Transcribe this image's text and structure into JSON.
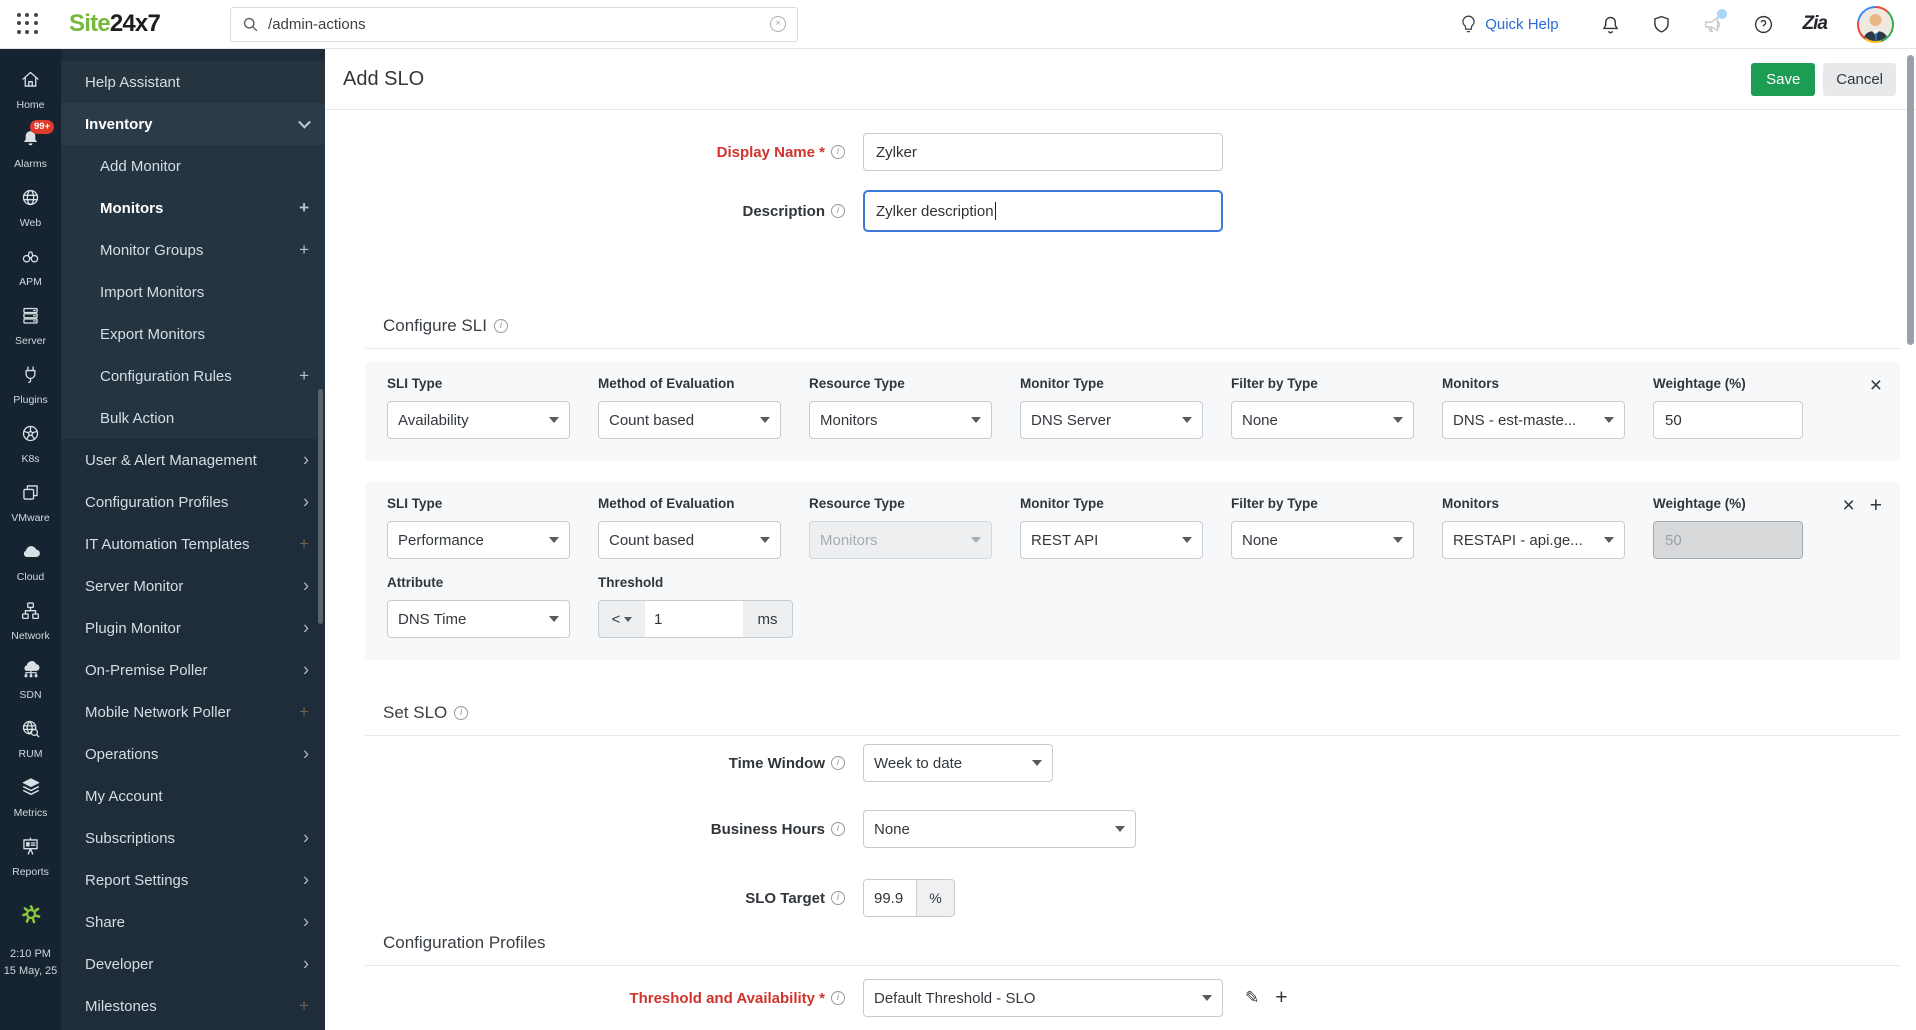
{
  "topbar": {
    "logo_primary": "Site",
    "logo_secondary": "24x7",
    "search_value": "/admin-actions",
    "quick_help": "Quick Help",
    "zia": "Zia"
  },
  "rail": {
    "items": [
      {
        "id": "home",
        "label": "Home",
        "icon": "home-icon"
      },
      {
        "id": "alarms",
        "label": "Alarms",
        "icon": "bell-icon",
        "badge": "99+"
      },
      {
        "id": "web",
        "label": "Web",
        "icon": "globe-icon"
      },
      {
        "id": "apm",
        "label": "APM",
        "icon": "binoculars-icon"
      },
      {
        "id": "server",
        "label": "Server",
        "icon": "server-icon"
      },
      {
        "id": "plugins",
        "label": "Plugins",
        "icon": "plug-icon"
      },
      {
        "id": "k8s",
        "label": "K8s",
        "icon": "kubernetes-icon"
      },
      {
        "id": "vmware",
        "label": "VMware",
        "icon": "vmware-icon"
      },
      {
        "id": "cloud",
        "label": "Cloud",
        "icon": "cloud-icon"
      },
      {
        "id": "network",
        "label": "Network",
        "icon": "network-icon"
      },
      {
        "id": "sdn",
        "label": "SDN",
        "icon": "sdn-icon"
      },
      {
        "id": "rum",
        "label": "RUM",
        "icon": "rum-icon"
      },
      {
        "id": "metrics",
        "label": "Metrics",
        "icon": "layers-icon"
      },
      {
        "id": "reports",
        "label": "Reports",
        "icon": "presentation-icon"
      }
    ],
    "clock_time": "2:10 PM",
    "clock_date": "15 May, 25"
  },
  "sidebar": {
    "items": [
      {
        "id": "help-assistant",
        "label": "Help Assistant",
        "style": "top-row"
      },
      {
        "id": "inventory",
        "label": "Inventory",
        "style": "section-open",
        "affordance": "chevron-down"
      },
      {
        "id": "add-monitor",
        "label": "Add Monitor",
        "style": "sub"
      },
      {
        "id": "monitors",
        "label": "Monitors",
        "style": "sub bold",
        "affordance": "plus"
      },
      {
        "id": "monitor-groups",
        "label": "Monitor Groups",
        "style": "sub",
        "affordance": "plus"
      },
      {
        "id": "import-monitors",
        "label": "Import Monitors",
        "style": "sub"
      },
      {
        "id": "export-monitors",
        "label": "Export Monitors",
        "style": "sub"
      },
      {
        "id": "configuration-rules",
        "label": "Configuration Rules",
        "style": "sub",
        "affordance": "plus"
      },
      {
        "id": "bulk-action",
        "label": "Bulk Action",
        "style": "sub"
      },
      {
        "id": "user-alert-management",
        "label": "User & Alert Management",
        "affordance": "chevron-right"
      },
      {
        "id": "configuration-profiles",
        "label": "Configuration Profiles",
        "affordance": "chevron-right"
      },
      {
        "id": "it-automation-templates",
        "label": "IT Automation Templates",
        "affordance": "plus-dim"
      },
      {
        "id": "server-monitor",
        "label": "Server Monitor",
        "affordance": "chevron-right"
      },
      {
        "id": "plugin-monitor",
        "label": "Plugin Monitor",
        "affordance": "chevron-right"
      },
      {
        "id": "on-premise-poller",
        "label": "On-Premise Poller",
        "affordance": "chevron-right"
      },
      {
        "id": "mobile-network-poller",
        "label": "Mobile Network Poller",
        "affordance": "plus-dim"
      },
      {
        "id": "operations",
        "label": "Operations",
        "affordance": "chevron-right"
      },
      {
        "id": "my-account",
        "label": "My Account"
      },
      {
        "id": "subscriptions",
        "label": "Subscriptions",
        "affordance": "chevron-right"
      },
      {
        "id": "report-settings",
        "label": "Report Settings",
        "affordance": "chevron-right"
      },
      {
        "id": "share",
        "label": "Share",
        "affordance": "chevron-right"
      },
      {
        "id": "developer",
        "label": "Developer",
        "affordance": "chevron-right"
      },
      {
        "id": "milestones",
        "label": "Milestones",
        "affordance": "plus-dim"
      }
    ]
  },
  "page": {
    "title": "Add SLO",
    "save": "Save",
    "cancel": "Cancel",
    "fields": {
      "display_name_label": "Display Name *",
      "display_name": "Zylker",
      "description_label": "Description",
      "description": "Zylker description"
    },
    "sli": {
      "heading": "Configure SLI",
      "columns": [
        "SLI Type",
        "Method of Evaluation",
        "Resource Type",
        "Monitor Type",
        "Filter by Type",
        "Monitors",
        "Weightage (%)"
      ],
      "rows": [
        {
          "sli_type": "Availability",
          "method": "Count based",
          "resource_type": "Monitors",
          "monitor_type": "DNS Server",
          "filter": "None",
          "monitors": "DNS - est-maste...",
          "weightage": "50"
        },
        {
          "sli_type": "Performance",
          "method": "Count based",
          "resource_type": "Monitors",
          "monitor_type": "REST API",
          "filter": "None",
          "monitors": "RESTAPI - api.ge...",
          "weightage": "50",
          "attribute_label": "Attribute",
          "attribute": "DNS Time",
          "threshold_label": "Threshold",
          "threshold_operator": "<",
          "threshold_value": "1",
          "threshold_unit": "ms"
        }
      ]
    },
    "slo": {
      "heading": "Set SLO",
      "time_window_label": "Time Window",
      "time_window": "Week to date",
      "business_hours_label": "Business Hours",
      "business_hours": "None",
      "target_label": "SLO Target",
      "target": "99.9",
      "target_unit": "%"
    },
    "profiles": {
      "heading": "Configuration Profiles",
      "threshold_label": "Threshold and Availability *",
      "value": "Default Threshold - SLO"
    }
  }
}
